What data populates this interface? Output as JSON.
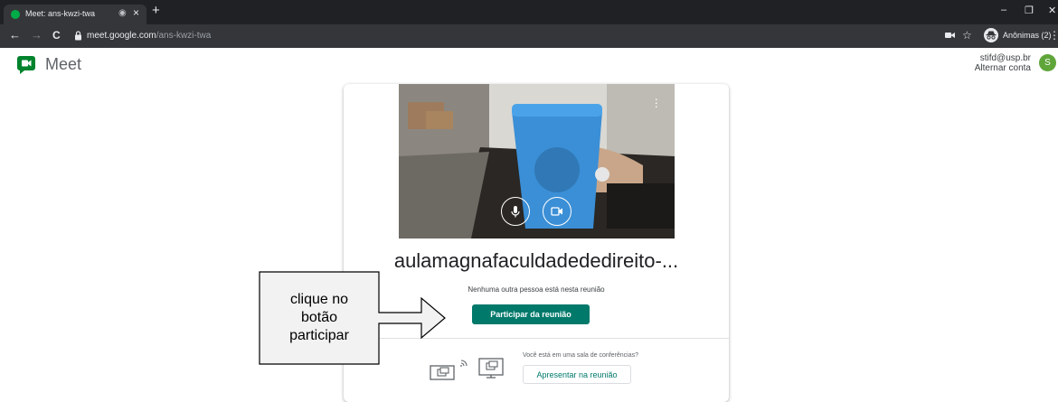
{
  "browser": {
    "tab_title": "Meet: ans-kwzi-twa",
    "tab_close": "×",
    "new_tab": "+",
    "window_controls": [
      "–",
      "❐",
      "✕"
    ],
    "nav": {
      "back": "←",
      "forward": "→",
      "reload": "C"
    },
    "url_host": "meet.google.com",
    "url_path": "/ans-kwzi-twa",
    "profile_label": "Anônimas (2)",
    "icons": [
      "tab-audio-icon",
      "lock-icon",
      "camera-icon",
      "star-icon",
      "incognito-icon",
      "more-vert-icon"
    ]
  },
  "meet": {
    "app_name": "Meet",
    "account_email": "stifd@usp.br",
    "switch_account": "Alternar conta",
    "avatar_initial": "S"
  },
  "card": {
    "meeting_name": "aulamagnafaculdadededireito-...",
    "empty_text": "Nenhuma outra pessoa está nesta reunião",
    "join_label": "Participar da reunião",
    "room_text": "Você está em uma sala de conferências?",
    "present_label": "Apresentar na reunião"
  },
  "annotation": {
    "line1": "clique no",
    "line2": "botão",
    "line3": "participar"
  },
  "colors": {
    "accent": "#00796b",
    "avatar": "#5fa53a",
    "chrome_dark": "#202124",
    "chrome_toolbar": "#35363a"
  }
}
